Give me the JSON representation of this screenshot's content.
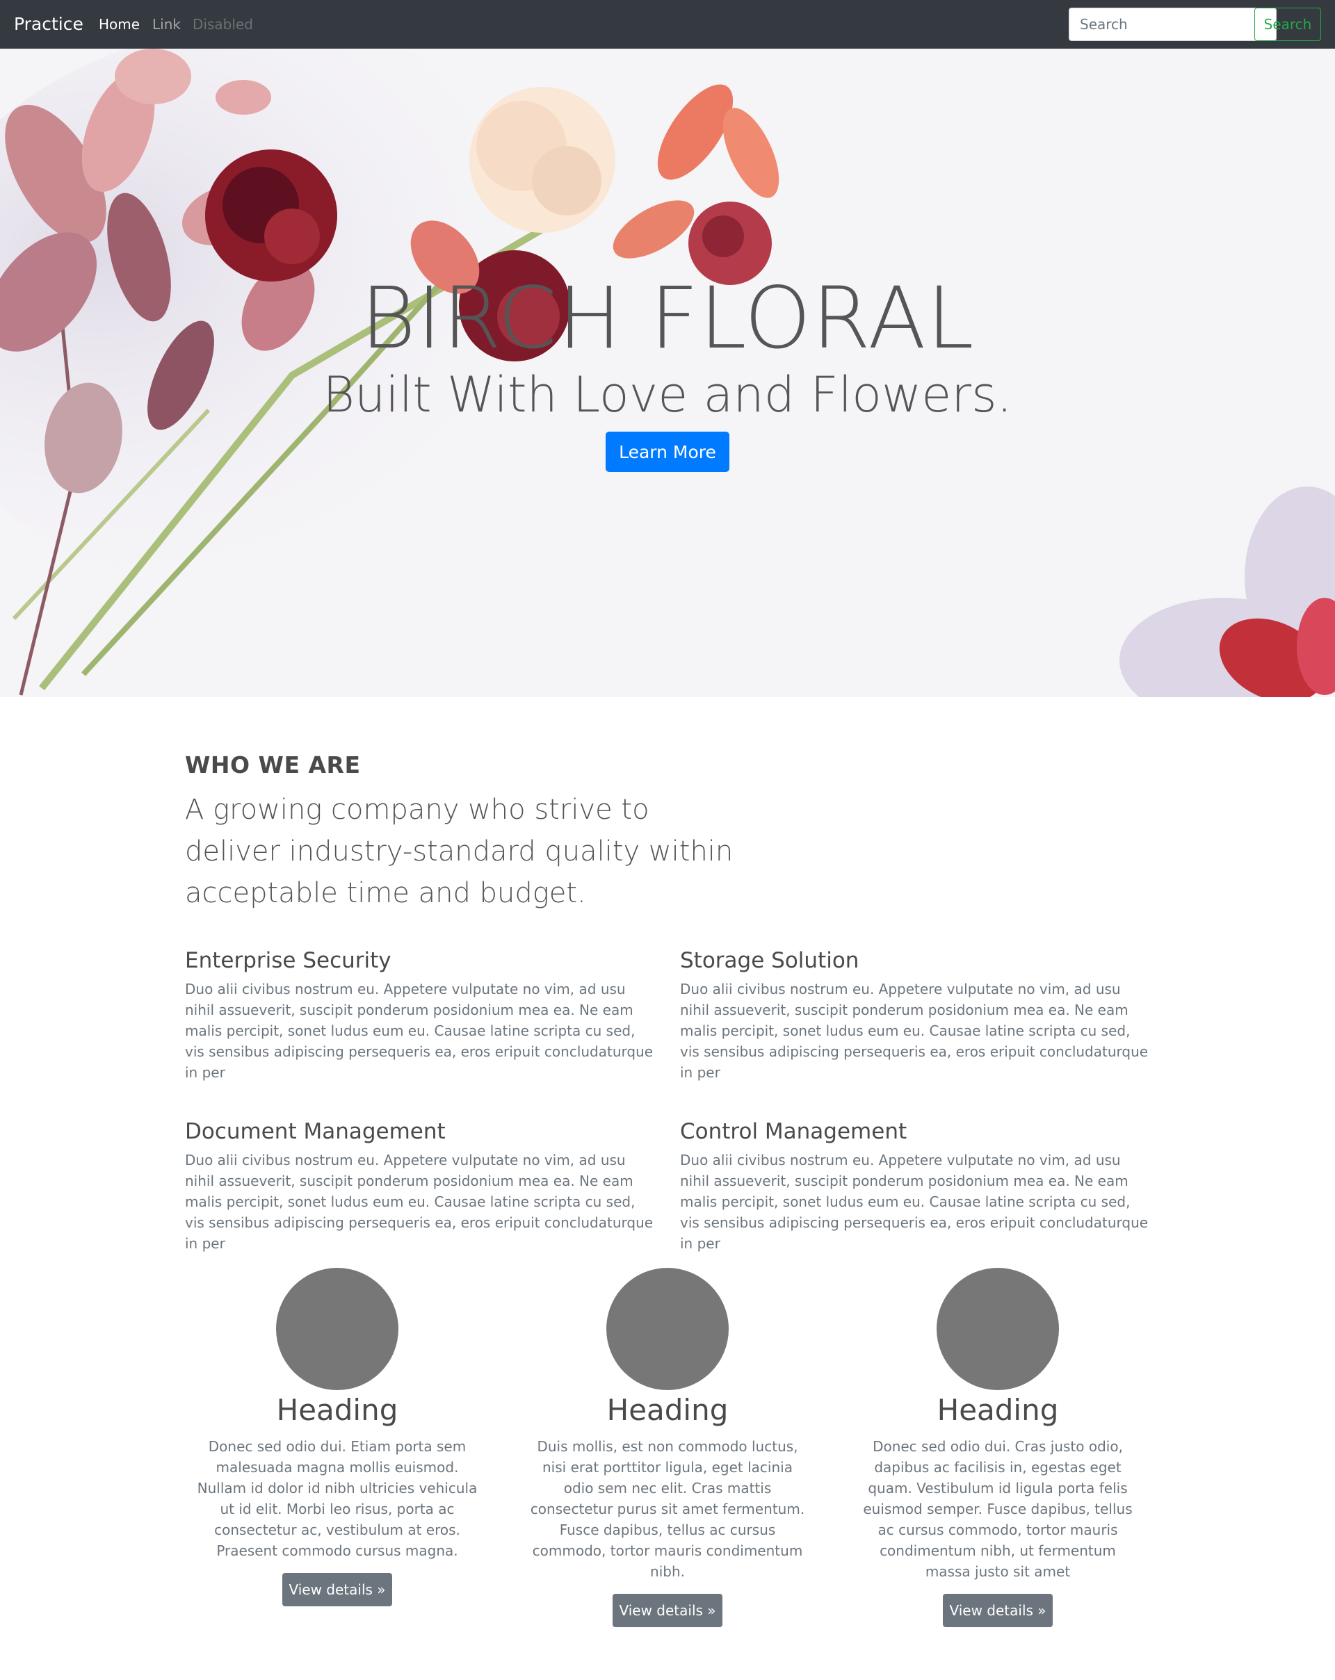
{
  "navbar": {
    "brand": "Practice",
    "links": [
      "Home",
      "Link",
      "Disabled"
    ],
    "search_placeholder": "Search",
    "search_button": "Search"
  },
  "hero": {
    "title": "BIRCH FLORAL",
    "subtitle": "Built With Love and Flowers.",
    "button": "Learn More"
  },
  "about": {
    "label": "WHO WE ARE",
    "lead": "A growing company who strive to deliver industry-standard quality within acceptable time and budget."
  },
  "features": [
    {
      "title": "Enterprise Security",
      "text": "Duo alii civibus nostrum eu. Appetere vulputate no vim, ad usu nihil assueverit, suscipit ponderum posidonium mea ea. Ne eam malis percipit, sonet ludus eum eu. Causae latine scripta cu sed, vis sensibus adipiscing persequeris ea, eros eripuit concludaturque in per"
    },
    {
      "title": "Storage Solution",
      "text": "Duo alii civibus nostrum eu. Appetere vulputate no vim, ad usu nihil assueverit, suscipit ponderum posidonium mea ea. Ne eam malis percipit, sonet ludus eum eu. Causae latine scripta cu sed, vis sensibus adipiscing persequeris ea, eros eripuit concludaturque in per"
    },
    {
      "title": "Document Management",
      "text": "Duo alii civibus nostrum eu. Appetere vulputate no vim, ad usu nihil assueverit, suscipit ponderum posidonium mea ea. Ne eam malis percipit, sonet ludus eum eu. Causae latine scripta cu sed, vis sensibus adipiscing persequeris ea, eros eripuit concludaturque in per"
    },
    {
      "title": "Control Management",
      "text": "Duo alii civibus nostrum eu. Appetere vulputate no vim, ad usu nihil assueverit, suscipit ponderum posidonium mea ea. Ne eam malis percipit, sonet ludus eum eu. Causae latine scripta cu sed, vis sensibus adipiscing persequeris ea, eros eripuit concludaturque in per"
    }
  ],
  "columns": [
    {
      "heading": "Heading",
      "text": "Donec sed odio dui. Etiam porta sem malesuada magna mollis euismod. Nullam id dolor id nibh ultricies vehicula ut id elit. Morbi leo risus, porta ac consectetur ac, vestibulum at eros. Praesent commodo cursus magna.",
      "button": "View details »"
    },
    {
      "heading": "Heading",
      "text": "Duis mollis, est non commodo luctus, nisi erat porttitor ligula, eget lacinia odio sem nec elit. Cras mattis consectetur purus sit amet fermentum. Fusce dapibus, tellus ac cursus commodo, tortor mauris condimentum nibh.",
      "button": "View details »"
    },
    {
      "heading": "Heading",
      "text": "Donec sed odio dui. Cras justo odio, dapibus ac facilisis in, egestas eget quam. Vestibulum id ligula porta felis euismod semper. Fusce dapibus, tellus ac cursus commodo, tortor mauris condimentum nibh, ut fermentum massa justo sit amet",
      "button": "View details »"
    }
  ],
  "colors": {
    "navbar_bg": "#343a40",
    "primary": "#007bff",
    "success_outline": "#28a745",
    "secondary": "#6c757d",
    "placeholder_circle": "#777777"
  }
}
